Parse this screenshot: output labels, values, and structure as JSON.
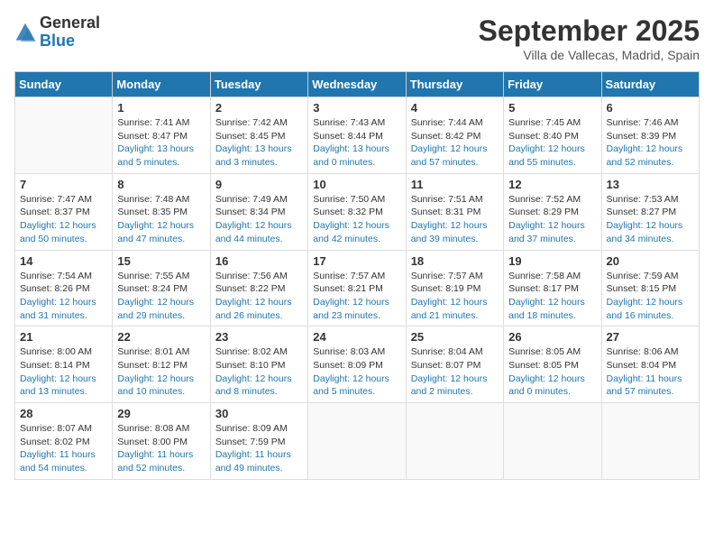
{
  "header": {
    "logo_general": "General",
    "logo_blue": "Blue",
    "month_title": "September 2025",
    "location": "Villa de Vallecas, Madrid, Spain"
  },
  "days_of_week": [
    "Sunday",
    "Monday",
    "Tuesday",
    "Wednesday",
    "Thursday",
    "Friday",
    "Saturday"
  ],
  "weeks": [
    [
      {
        "day": "",
        "sunrise": "",
        "sunset": "",
        "daylight": ""
      },
      {
        "day": "1",
        "sunrise": "Sunrise: 7:41 AM",
        "sunset": "Sunset: 8:47 PM",
        "daylight": "Daylight: 13 hours and 5 minutes."
      },
      {
        "day": "2",
        "sunrise": "Sunrise: 7:42 AM",
        "sunset": "Sunset: 8:45 PM",
        "daylight": "Daylight: 13 hours and 3 minutes."
      },
      {
        "day": "3",
        "sunrise": "Sunrise: 7:43 AM",
        "sunset": "Sunset: 8:44 PM",
        "daylight": "Daylight: 13 hours and 0 minutes."
      },
      {
        "day": "4",
        "sunrise": "Sunrise: 7:44 AM",
        "sunset": "Sunset: 8:42 PM",
        "daylight": "Daylight: 12 hours and 57 minutes."
      },
      {
        "day": "5",
        "sunrise": "Sunrise: 7:45 AM",
        "sunset": "Sunset: 8:40 PM",
        "daylight": "Daylight: 12 hours and 55 minutes."
      },
      {
        "day": "6",
        "sunrise": "Sunrise: 7:46 AM",
        "sunset": "Sunset: 8:39 PM",
        "daylight": "Daylight: 12 hours and 52 minutes."
      }
    ],
    [
      {
        "day": "7",
        "sunrise": "Sunrise: 7:47 AM",
        "sunset": "Sunset: 8:37 PM",
        "daylight": "Daylight: 12 hours and 50 minutes."
      },
      {
        "day": "8",
        "sunrise": "Sunrise: 7:48 AM",
        "sunset": "Sunset: 8:35 PM",
        "daylight": "Daylight: 12 hours and 47 minutes."
      },
      {
        "day": "9",
        "sunrise": "Sunrise: 7:49 AM",
        "sunset": "Sunset: 8:34 PM",
        "daylight": "Daylight: 12 hours and 44 minutes."
      },
      {
        "day": "10",
        "sunrise": "Sunrise: 7:50 AM",
        "sunset": "Sunset: 8:32 PM",
        "daylight": "Daylight: 12 hours and 42 minutes."
      },
      {
        "day": "11",
        "sunrise": "Sunrise: 7:51 AM",
        "sunset": "Sunset: 8:31 PM",
        "daylight": "Daylight: 12 hours and 39 minutes."
      },
      {
        "day": "12",
        "sunrise": "Sunrise: 7:52 AM",
        "sunset": "Sunset: 8:29 PM",
        "daylight": "Daylight: 12 hours and 37 minutes."
      },
      {
        "day": "13",
        "sunrise": "Sunrise: 7:53 AM",
        "sunset": "Sunset: 8:27 PM",
        "daylight": "Daylight: 12 hours and 34 minutes."
      }
    ],
    [
      {
        "day": "14",
        "sunrise": "Sunrise: 7:54 AM",
        "sunset": "Sunset: 8:26 PM",
        "daylight": "Daylight: 12 hours and 31 minutes."
      },
      {
        "day": "15",
        "sunrise": "Sunrise: 7:55 AM",
        "sunset": "Sunset: 8:24 PM",
        "daylight": "Daylight: 12 hours and 29 minutes."
      },
      {
        "day": "16",
        "sunrise": "Sunrise: 7:56 AM",
        "sunset": "Sunset: 8:22 PM",
        "daylight": "Daylight: 12 hours and 26 minutes."
      },
      {
        "day": "17",
        "sunrise": "Sunrise: 7:57 AM",
        "sunset": "Sunset: 8:21 PM",
        "daylight": "Daylight: 12 hours and 23 minutes."
      },
      {
        "day": "18",
        "sunrise": "Sunrise: 7:57 AM",
        "sunset": "Sunset: 8:19 PM",
        "daylight": "Daylight: 12 hours and 21 minutes."
      },
      {
        "day": "19",
        "sunrise": "Sunrise: 7:58 AM",
        "sunset": "Sunset: 8:17 PM",
        "daylight": "Daylight: 12 hours and 18 minutes."
      },
      {
        "day": "20",
        "sunrise": "Sunrise: 7:59 AM",
        "sunset": "Sunset: 8:15 PM",
        "daylight": "Daylight: 12 hours and 16 minutes."
      }
    ],
    [
      {
        "day": "21",
        "sunrise": "Sunrise: 8:00 AM",
        "sunset": "Sunset: 8:14 PM",
        "daylight": "Daylight: 12 hours and 13 minutes."
      },
      {
        "day": "22",
        "sunrise": "Sunrise: 8:01 AM",
        "sunset": "Sunset: 8:12 PM",
        "daylight": "Daylight: 12 hours and 10 minutes."
      },
      {
        "day": "23",
        "sunrise": "Sunrise: 8:02 AM",
        "sunset": "Sunset: 8:10 PM",
        "daylight": "Daylight: 12 hours and 8 minutes."
      },
      {
        "day": "24",
        "sunrise": "Sunrise: 8:03 AM",
        "sunset": "Sunset: 8:09 PM",
        "daylight": "Daylight: 12 hours and 5 minutes."
      },
      {
        "day": "25",
        "sunrise": "Sunrise: 8:04 AM",
        "sunset": "Sunset: 8:07 PM",
        "daylight": "Daylight: 12 hours and 2 minutes."
      },
      {
        "day": "26",
        "sunrise": "Sunrise: 8:05 AM",
        "sunset": "Sunset: 8:05 PM",
        "daylight": "Daylight: 12 hours and 0 minutes."
      },
      {
        "day": "27",
        "sunrise": "Sunrise: 8:06 AM",
        "sunset": "Sunset: 8:04 PM",
        "daylight": "Daylight: 11 hours and 57 minutes."
      }
    ],
    [
      {
        "day": "28",
        "sunrise": "Sunrise: 8:07 AM",
        "sunset": "Sunset: 8:02 PM",
        "daylight": "Daylight: 11 hours and 54 minutes."
      },
      {
        "day": "29",
        "sunrise": "Sunrise: 8:08 AM",
        "sunset": "Sunset: 8:00 PM",
        "daylight": "Daylight: 11 hours and 52 minutes."
      },
      {
        "day": "30",
        "sunrise": "Sunrise: 8:09 AM",
        "sunset": "Sunset: 7:59 PM",
        "daylight": "Daylight: 11 hours and 49 minutes."
      },
      {
        "day": "",
        "sunrise": "",
        "sunset": "",
        "daylight": ""
      },
      {
        "day": "",
        "sunrise": "",
        "sunset": "",
        "daylight": ""
      },
      {
        "day": "",
        "sunrise": "",
        "sunset": "",
        "daylight": ""
      },
      {
        "day": "",
        "sunrise": "",
        "sunset": "",
        "daylight": ""
      }
    ]
  ]
}
